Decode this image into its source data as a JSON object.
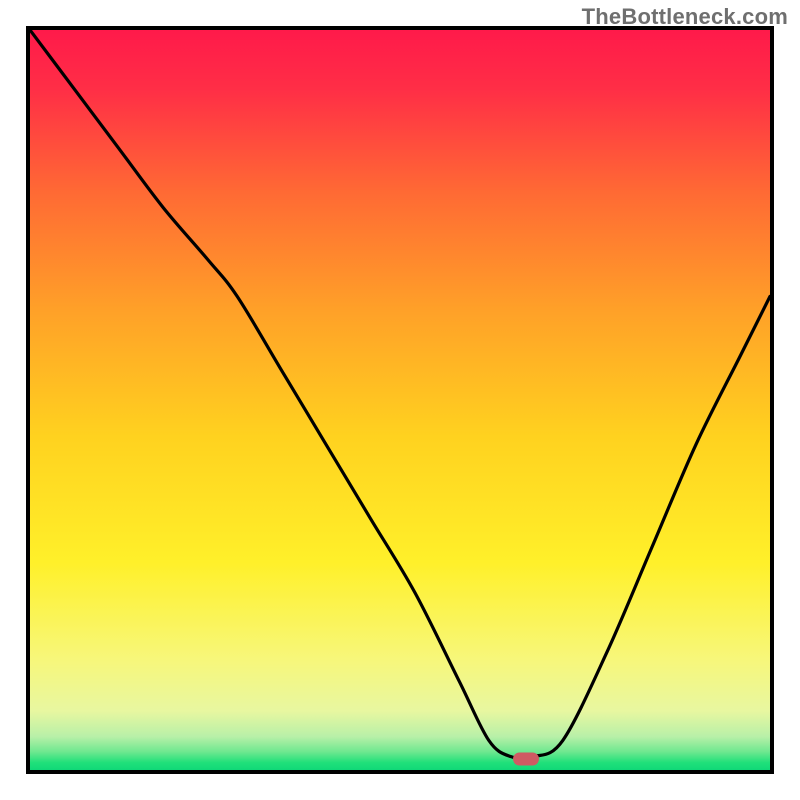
{
  "watermark": "TheBottleneck.com",
  "chart_data": {
    "type": "line",
    "title": "",
    "xlabel": "",
    "ylabel": "",
    "xlim": [
      0,
      1
    ],
    "ylim": [
      0,
      1
    ],
    "colors": {
      "top": "#ff1a4a",
      "mid_upper": "#ff8a2a",
      "mid": "#ffd21f",
      "mid_lower": "#f7f77a",
      "bottom": "#10e07a"
    },
    "marker": {
      "x": 0.67,
      "y": 0.015,
      "color": "#cf5b63"
    },
    "series": [
      {
        "name": "bottleneck-curve",
        "x": [
          0.0,
          0.06,
          0.12,
          0.18,
          0.24,
          0.28,
          0.34,
          0.4,
          0.46,
          0.52,
          0.58,
          0.62,
          0.65,
          0.68,
          0.72,
          0.78,
          0.84,
          0.9,
          0.96,
          1.0
        ],
        "y": [
          1.0,
          0.92,
          0.84,
          0.76,
          0.69,
          0.64,
          0.54,
          0.44,
          0.34,
          0.24,
          0.12,
          0.04,
          0.018,
          0.018,
          0.04,
          0.16,
          0.3,
          0.44,
          0.56,
          0.64
        ]
      }
    ]
  }
}
